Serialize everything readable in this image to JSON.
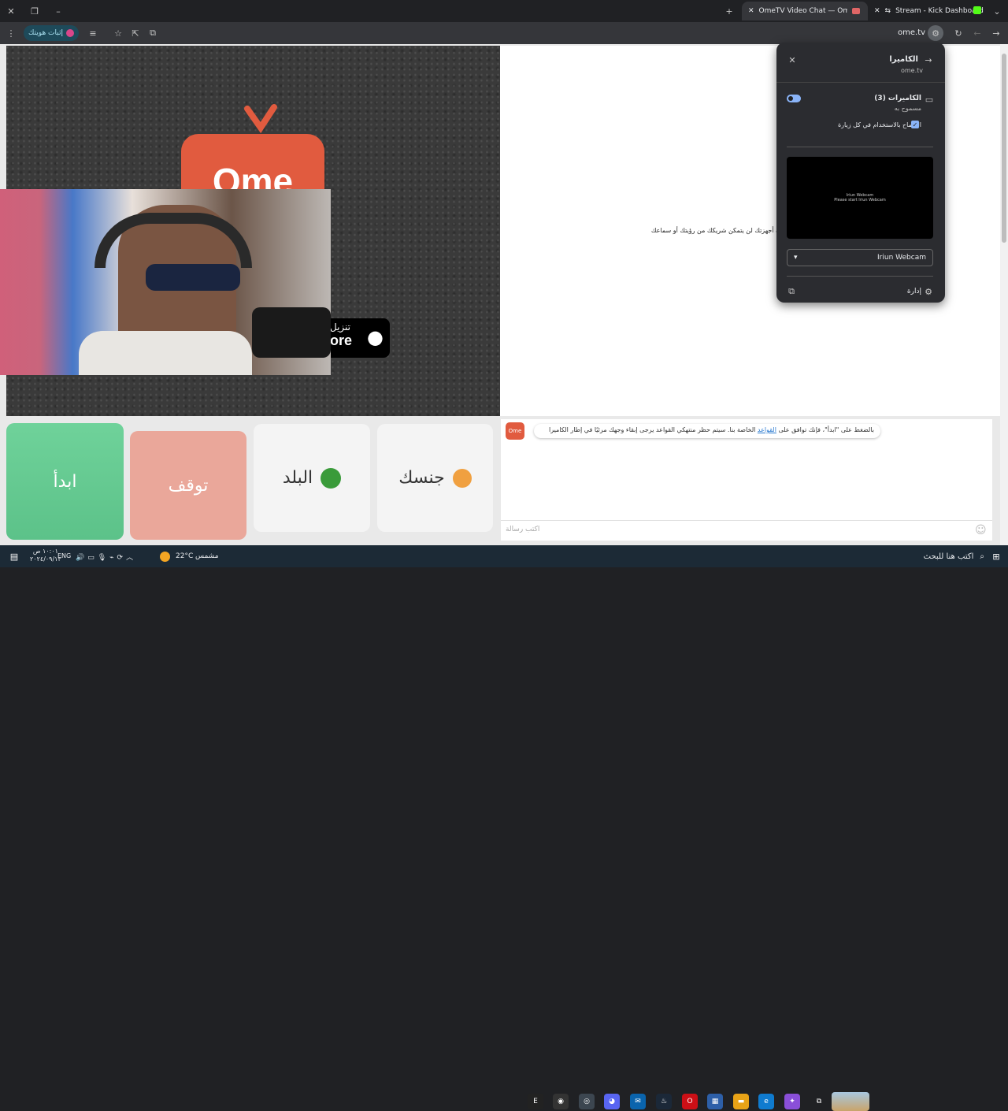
{
  "tabs": [
    {
      "label": "OmeTV Video Chat — Omegle",
      "active": true
    },
    {
      "label": "Stream - Kick Dashboard",
      "active": false
    }
  ],
  "toolbar": {
    "url": "ome.tv",
    "verify_label": "إثبات هويتك"
  },
  "page": {
    "logo_text": "Ome",
    "store_text_top": "تنزيل",
    "store_text_bottom": "ore",
    "partner_message": "ن أجهزتك لن يتمكن شريكك من رؤيتك أو سماعك",
    "rules_message_pre": "بالضغط على \"ابدأ\"، فإنك توافق على ",
    "rules_link": "القواعد",
    "rules_message_post": " الخاصة بنا. سيتم حظر منتهكي القواعد يرجى إبقاء وجهك مرئيًا في إطار الكاميرا",
    "chat_placeholder": "اكتب رسالة",
    "buttons": {
      "start": "ابدأ",
      "stop": "توقف",
      "country": "البلد",
      "gender": "جنسك"
    }
  },
  "popup": {
    "title": "الكاميرا",
    "site": "ome.tv",
    "cameras_label": "الكاميرات (3)",
    "cameras_status": "مسموح به",
    "allow_always_label": "السماح بالاستخدام في كل زيارة",
    "preview_text": "Iriun Webcam",
    "preview_line1": "Iriun Webcam",
    "preview_line2": "Please start Iriun Webcam",
    "selected_camera": "Iriun Webcam",
    "manage_label": "إدارة"
  },
  "taskbar": {
    "search_placeholder": "اكتب هنا للبحث",
    "weather_temp": "22°C",
    "weather_text": "مشمس",
    "lang": "ENG",
    "time": "١٠:٠١ ص",
    "date": "٢٠٢٤/٠٩/١٣"
  },
  "colors": {
    "start": "#6fcf97",
    "stop": "#eaa79a",
    "accent": "#8ab4f8",
    "logo": "#e15b3f"
  }
}
